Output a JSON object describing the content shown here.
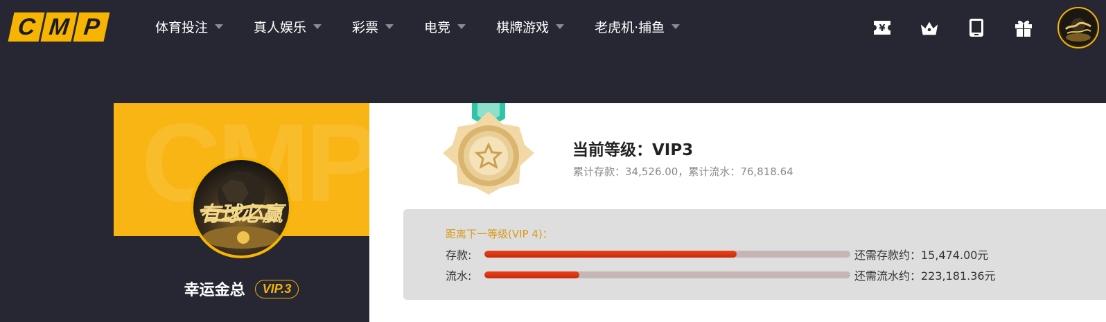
{
  "logo": {
    "letters": [
      "C",
      "M",
      "P"
    ]
  },
  "nav": {
    "items": [
      {
        "label": "体育投注"
      },
      {
        "label": "真人娱乐"
      },
      {
        "label": "彩票"
      },
      {
        "label": "电竞"
      },
      {
        "label": "棋牌游戏"
      },
      {
        "label": "老虎机·捕鱼"
      }
    ]
  },
  "header_icons": [
    "ticket-yen-icon",
    "crown-icon",
    "tablet-icon",
    "gift-icon"
  ],
  "profile": {
    "watermark": "CMP",
    "avatar_text": "有球必赢",
    "username": "幸运金总",
    "vip_badge": "VIP.3"
  },
  "level": {
    "current_label": "当前等级：VIP3",
    "stats": "累计存款：34,526.00，累计流水：76,818.64",
    "next_level_label": "距离下一等级(VIP 4)：",
    "rows": [
      {
        "label": "存款:",
        "progress": 0.69,
        "remaining": "还需存款约：15,474.00元"
      },
      {
        "label": "流水:",
        "progress": 0.26,
        "remaining": "还需流水约：223,181.36元"
      }
    ]
  },
  "colors": {
    "accent": "#f7b400",
    "background": "#262733",
    "progress_fill": "#d8350f",
    "progress_track": "#c5b6b5",
    "next_level_text": "#d69a1c"
  }
}
